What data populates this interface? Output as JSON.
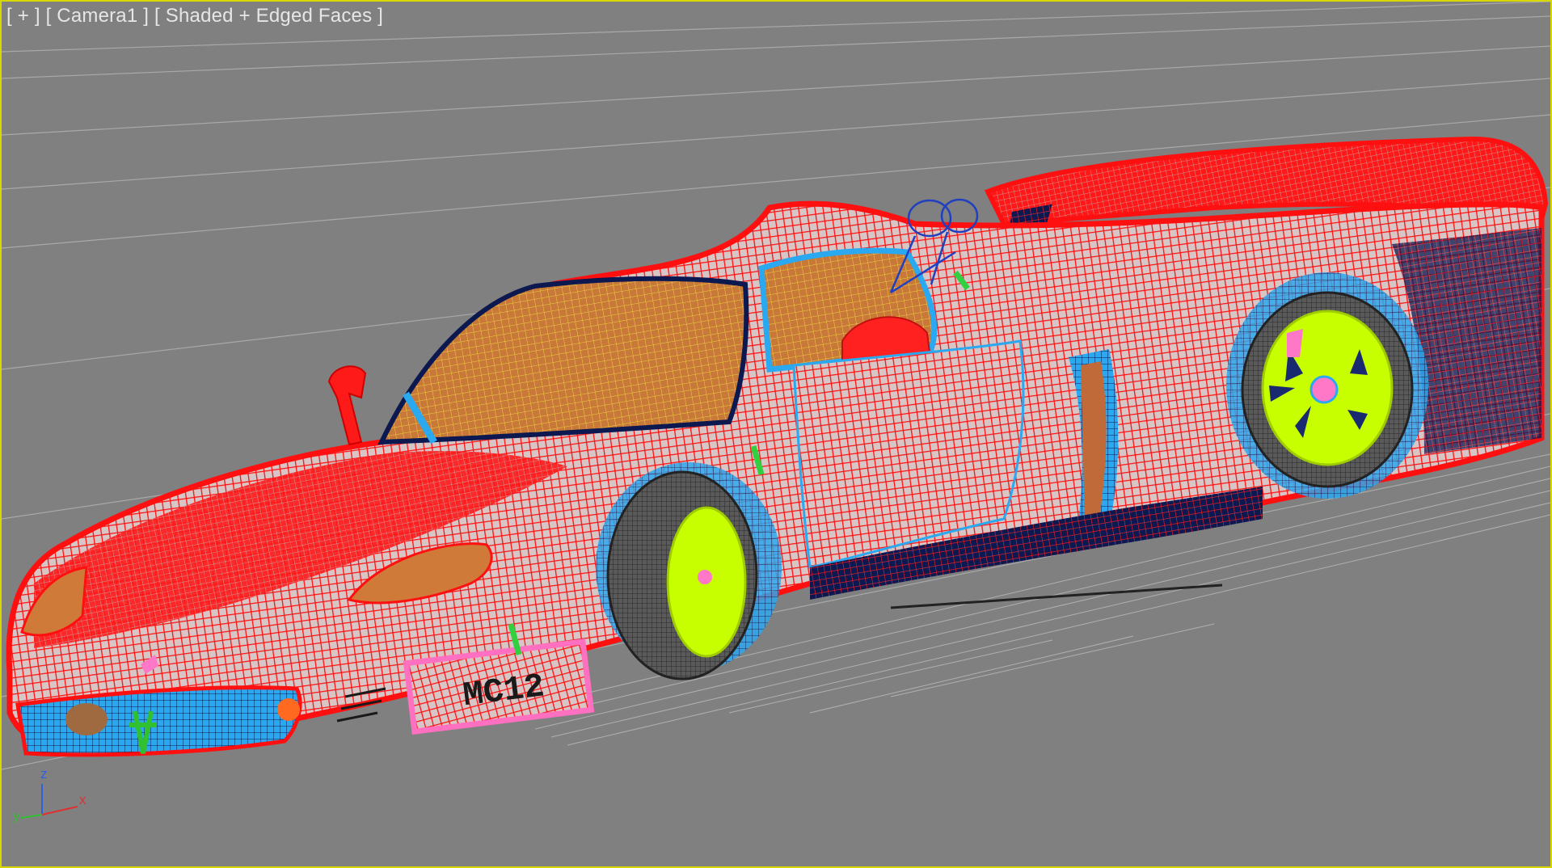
{
  "viewport": {
    "label_plus": "[ + ]",
    "label_camera": "[ Camera1 ]",
    "label_mode": "[ Shaded + Edged Faces ]"
  },
  "axis": {
    "x": "x",
    "y": "y",
    "z": "z",
    "colors": {
      "x": "#e03030",
      "y": "#30c030",
      "z": "#3060e0"
    }
  },
  "model": {
    "plate_text": "MC12",
    "colors": {
      "body": "#ff1010",
      "wheel_rim": "#c8ff00",
      "tire": "#505050",
      "glass": "#c87838",
      "trim": "#2aa8f0",
      "plate": "#ff70c0",
      "dark": "#0c1850"
    }
  },
  "colors": {
    "background": "#808080",
    "border_active": "#d8d800",
    "grid": "#a8a8a8",
    "label_text": "#e6e6e6"
  }
}
